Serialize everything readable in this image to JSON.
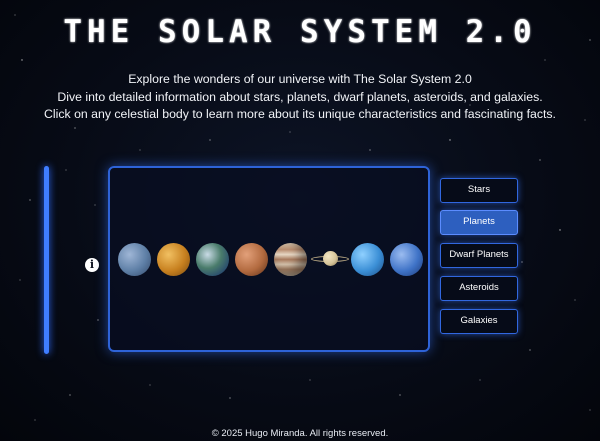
{
  "header": {
    "title": "THE SOLAR SYSTEM 2.0"
  },
  "intro": {
    "line1": "Explore the wonders of our universe with The Solar System 2.0",
    "line2": "Dive into detailed information about stars, planets, dwarf planets, asteroids, and galaxies.",
    "line3": "Click on any celestial body to learn more about its unique characteristics and fascinating facts."
  },
  "info": {
    "icon": "info-icon",
    "glyph": "i"
  },
  "planets": [
    {
      "name": "mercury",
      "color": "#5e7fa6"
    },
    {
      "name": "venus",
      "color": "#c7801f"
    },
    {
      "name": "earth",
      "color": "#4a7c6b"
    },
    {
      "name": "mars",
      "color": "#b26a3f"
    },
    {
      "name": "jupiter",
      "color": "#c9b49b"
    },
    {
      "name": "saturn",
      "color": "#d6c49a"
    },
    {
      "name": "uranus",
      "color": "#3b8fd6"
    },
    {
      "name": "neptune",
      "color": "#3f73c7"
    }
  ],
  "menu": {
    "items": [
      "Stars",
      "Planets",
      "Dwarf Planets",
      "Asteroids",
      "Galaxies"
    ],
    "active": "Planets"
  },
  "footer": {
    "text": "© 2025 Hugo Miranda. All rights reserved."
  },
  "colors": {
    "accent": "#2e63d8",
    "active_button": "#2d5fbf"
  }
}
